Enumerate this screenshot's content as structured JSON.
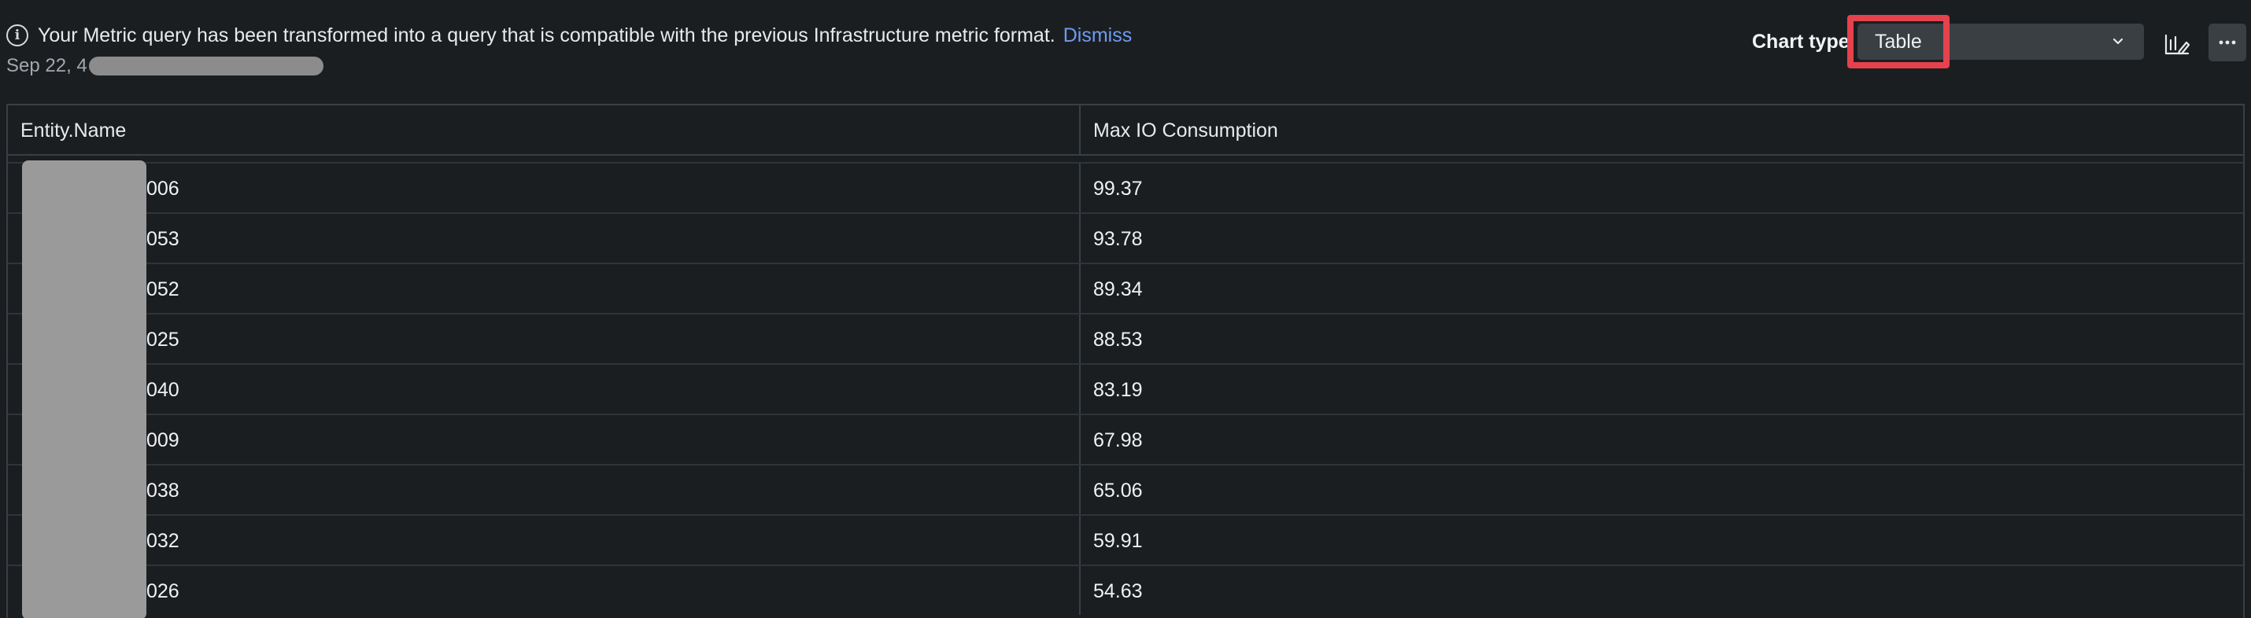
{
  "notice": {
    "message": "Your Metric query has been transformed into a query that is compatible with the previous Infrastructure metric format.",
    "dismiss_label": "Dismiss",
    "icon": "info-icon"
  },
  "timestamp": {
    "visible_prefix": "Sep 22, 4"
  },
  "chart_type": {
    "label": "Chart type",
    "selected": "Table",
    "chevron_icon": "chevron-down-icon"
  },
  "toolbar": {
    "edit_icon": "chart-edit-icon",
    "more_label": "···"
  },
  "table": {
    "columns": [
      "Entity.Name",
      "Max IO Consumption"
    ],
    "rows": [
      {
        "name_suffix": "006",
        "value": "99.37"
      },
      {
        "name_suffix": "053",
        "value": "93.78"
      },
      {
        "name_suffix": "052",
        "value": "89.34"
      },
      {
        "name_suffix": "025",
        "value": "88.53"
      },
      {
        "name_suffix": "040",
        "value": "83.19"
      },
      {
        "name_suffix": "009",
        "value": "67.98"
      },
      {
        "name_suffix": "038",
        "value": "65.06"
      },
      {
        "name_suffix": "032",
        "value": "59.91"
      },
      {
        "name_suffix": "026",
        "value": "54.63"
      }
    ]
  },
  "colors": {
    "background": "#1b1e21",
    "link": "#6e9bf0",
    "highlight": "#e5424d",
    "redaction": "#9a9a9a"
  }
}
